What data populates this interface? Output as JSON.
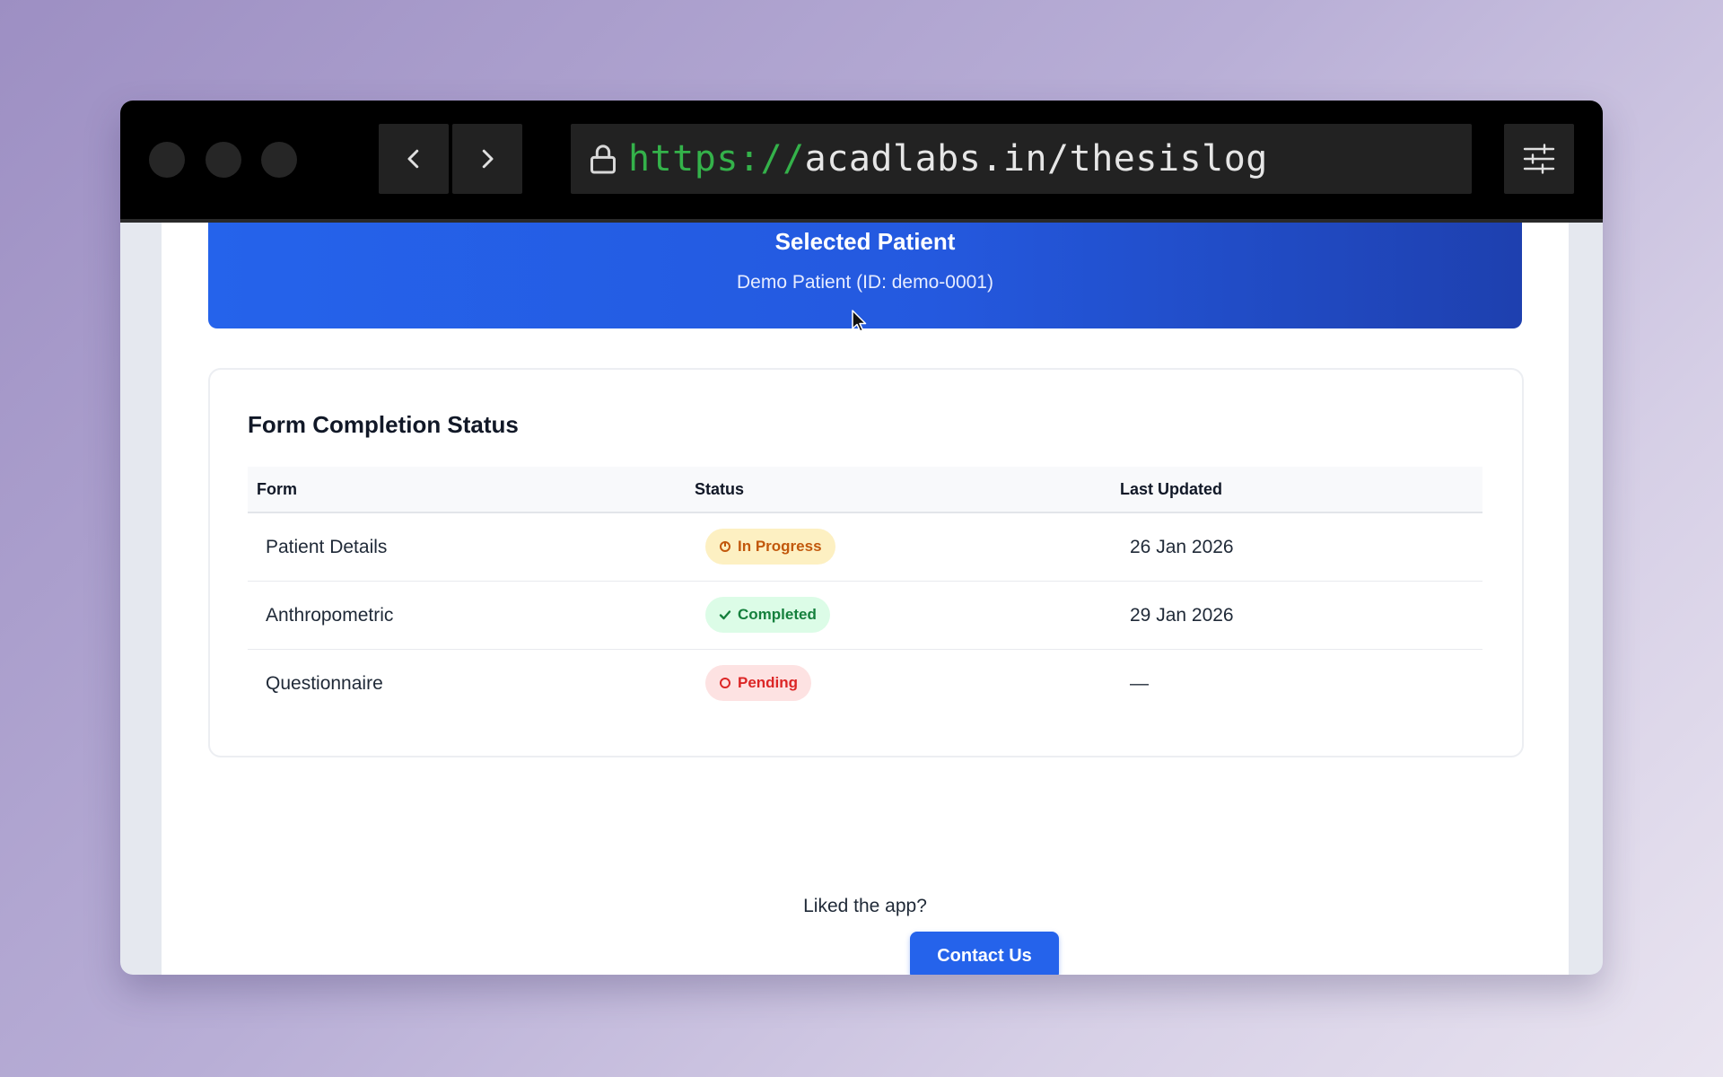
{
  "browser": {
    "url_scheme": "https://",
    "url_rest": "acadlabs.in/thesislog"
  },
  "patient": {
    "title": "Selected Patient",
    "subtitle": "Demo Patient (ID: demo-0001)"
  },
  "forms": {
    "title": "Form Completion Status",
    "columns": [
      "Form",
      "Status",
      "Last Updated"
    ],
    "rows": [
      {
        "form": "Patient Details",
        "status": "In Progress",
        "status_type": "in-progress",
        "updated": "26 Jan 2026"
      },
      {
        "form": "Anthropometric",
        "status": "Completed",
        "status_type": "completed",
        "updated": "29 Jan 2026"
      },
      {
        "form": "Questionnaire",
        "status": "Pending",
        "status_type": "pending",
        "updated": "—"
      }
    ]
  },
  "footer": {
    "prompt": "Liked the app?",
    "contact_label": "Contact Us"
  },
  "colors": {
    "primary": "#2563eb",
    "in_progress": "#c2580c",
    "completed": "#15803d",
    "pending": "#dc2626"
  }
}
